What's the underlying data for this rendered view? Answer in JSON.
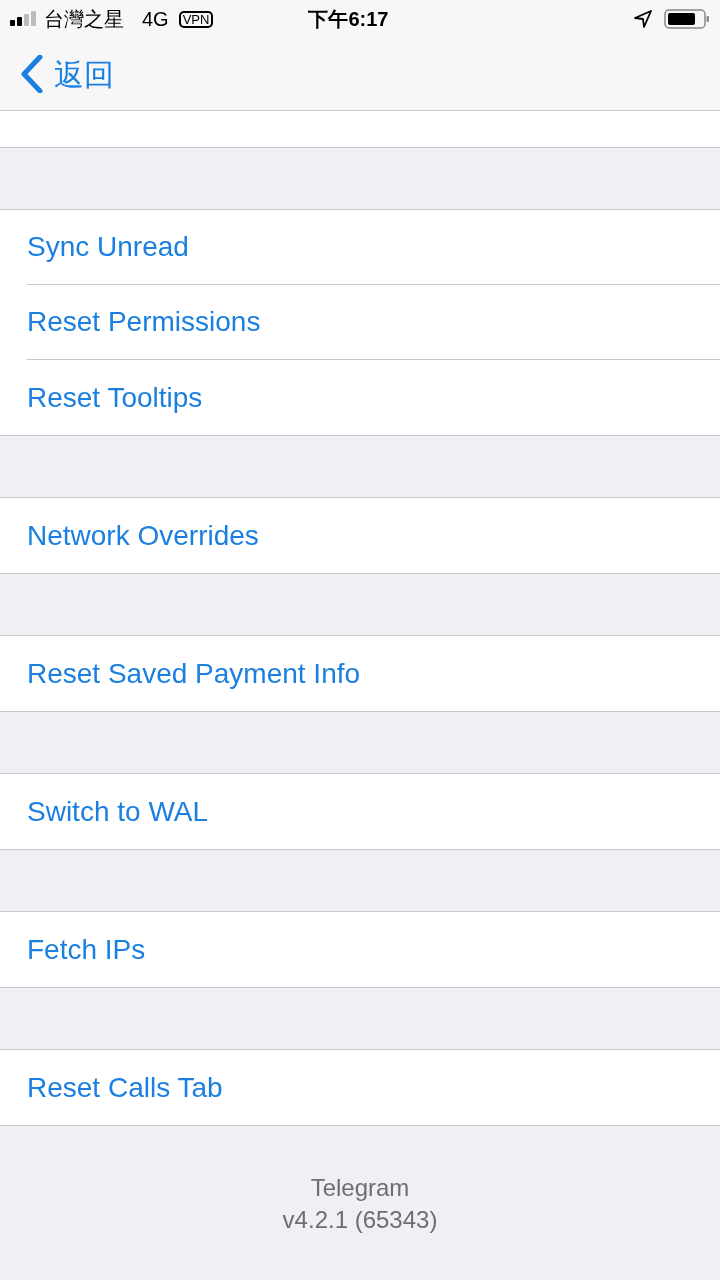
{
  "status_bar": {
    "carrier": "台灣之星",
    "network": "4G",
    "vpn": "VPN",
    "time": "下午6:17"
  },
  "nav": {
    "back": "返回"
  },
  "groups": [
    {
      "items": [
        "Sync Unread",
        "Reset Permissions",
        "Reset Tooltips"
      ]
    },
    {
      "items": [
        "Network Overrides"
      ]
    },
    {
      "items": [
        "Reset Saved Payment Info"
      ]
    },
    {
      "items": [
        "Switch to WAL"
      ]
    },
    {
      "items": [
        "Fetch IPs"
      ]
    },
    {
      "items": [
        "Reset Calls Tab"
      ]
    }
  ],
  "footer": {
    "app": "Telegram",
    "version": "v4.2.1 (65343)"
  }
}
